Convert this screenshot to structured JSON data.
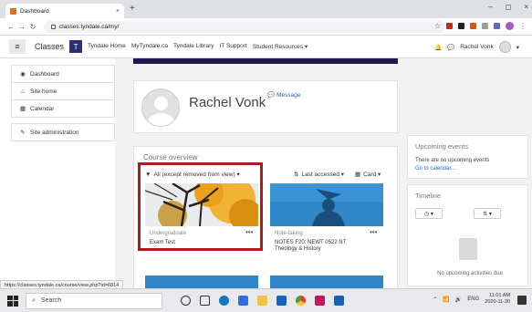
{
  "browser": {
    "tab_title": "Dashboard",
    "tab_close": "×",
    "new_tab": "+",
    "win_controls": [
      "–",
      "◻",
      "×"
    ],
    "url": "classes.tyndale.ca/my/",
    "status_url": "https://classes.tyndale.ca/course/view.php?id=6814"
  },
  "navbar": {
    "brand": "Classes",
    "logo_letter": "T",
    "links": [
      "Tyndale Home",
      "MyTyndale.ca",
      "Tyndale Library",
      "IT Support",
      "Student Resources ▾"
    ],
    "user_name": "Rachel Vonk",
    "user_caret": "▾"
  },
  "sidebar": {
    "group1": [
      {
        "label": "Dashboard",
        "icon": "tachometer-icon"
      },
      {
        "label": "Site home",
        "icon": "home-icon"
      },
      {
        "label": "Calendar",
        "icon": "calendar-icon"
      }
    ],
    "group2": [
      {
        "label": "Site administration",
        "icon": "wrench-icon"
      }
    ]
  },
  "profile": {
    "name": "Rachel Vonk",
    "message_label": "Message"
  },
  "course_overview": {
    "title": "Course overview",
    "filter_label": "All (except removed from view) ▾",
    "sort_label": "Last accessed ▾",
    "view_label": "Card ▾",
    "courses": [
      {
        "category": "Undergraduate",
        "name": "Exam Test",
        "name2": ""
      },
      {
        "category": "Note-taking",
        "name": "NOTES F20: NEWT 0522 NT",
        "name2": "Theology & History"
      }
    ],
    "more": "•••"
  },
  "upcoming": {
    "title": "Upcoming events",
    "empty": "There are no upcoming events",
    "link": "Go to calendar..."
  },
  "timeline": {
    "title": "Timeline",
    "btn1": "◷ ▾",
    "btn2": "⇅ ▾",
    "empty": "No upcoming activities due"
  },
  "taskbar": {
    "search_placeholder": "Search",
    "lang": "ENG",
    "time": "11:01 AM",
    "date": "2020-11-30"
  },
  "colors": {
    "highlight": "#b0191e",
    "link": "#1f6ad1",
    "brand_dark": "#1d1a4f"
  }
}
